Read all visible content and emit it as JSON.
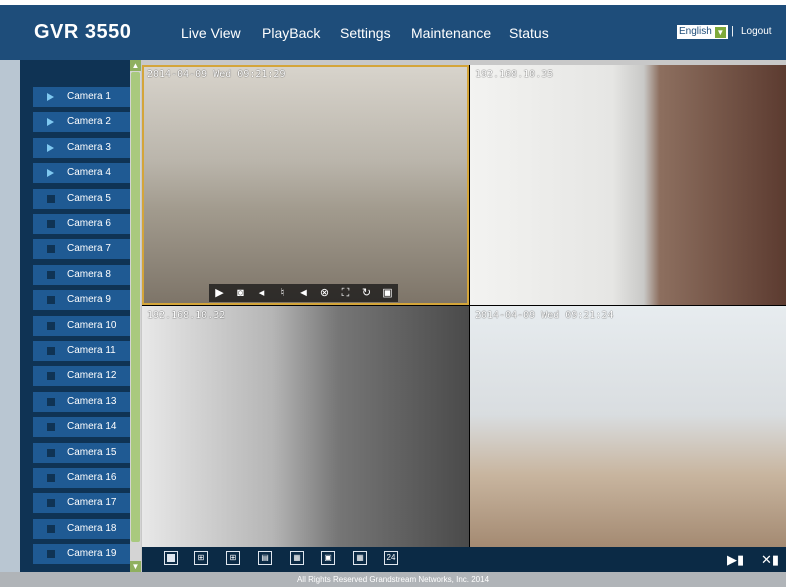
{
  "app": {
    "brand": "GVR 3550"
  },
  "nav": [
    "Live View",
    "PlayBack",
    "Settings",
    "Maintenance",
    "Status"
  ],
  "language": {
    "selected": "English"
  },
  "separator": "|",
  "logout": "Logout",
  "cameras": [
    {
      "label": "Camera 1",
      "active": true
    },
    {
      "label": "Camera 2",
      "active": true
    },
    {
      "label": "Camera 3",
      "active": true
    },
    {
      "label": "Camera 4",
      "active": true
    },
    {
      "label": "Camera 5",
      "active": false
    },
    {
      "label": "Camera 6",
      "active": false
    },
    {
      "label": "Camera 7",
      "active": false
    },
    {
      "label": "Camera 8",
      "active": false
    },
    {
      "label": "Camera 9",
      "active": false
    },
    {
      "label": "Camera 10",
      "active": false
    },
    {
      "label": "Camera 11",
      "active": false
    },
    {
      "label": "Camera 12",
      "active": false
    },
    {
      "label": "Camera 13",
      "active": false
    },
    {
      "label": "Camera 14",
      "active": false
    },
    {
      "label": "Camera 15",
      "active": false
    },
    {
      "label": "Camera 16",
      "active": false
    },
    {
      "label": "Camera 17",
      "active": false
    },
    {
      "label": "Camera 18",
      "active": false
    },
    {
      "label": "Camera 19",
      "active": false
    }
  ],
  "views": [
    {
      "osd": "2014-04-09 Wed 09:21:29"
    },
    {
      "osd": "192.168.10.35"
    },
    {
      "osd": "192.168.10.32"
    },
    {
      "osd": "2014-04-09 Wed 09:21:24"
    }
  ],
  "view_toolbar": [
    "record-icon",
    "snapshot-icon",
    "mute-icon",
    "microphone-icon",
    "ptz-icon",
    "close-stream-icon",
    "fullscreen-icon",
    "refresh-icon",
    "picture-icon"
  ],
  "layouts": [
    "1",
    "4",
    "6",
    "8",
    "9",
    "13",
    "16",
    "24"
  ],
  "layout_24_label": "24",
  "footer": "All Rights Reserved Grandstream Networks, Inc. 2014",
  "colors": {
    "header": "#1e4d7a",
    "sidebar": "#0f3354",
    "camera_button": "#1f5a93",
    "selected_border": "#d4a53a"
  }
}
